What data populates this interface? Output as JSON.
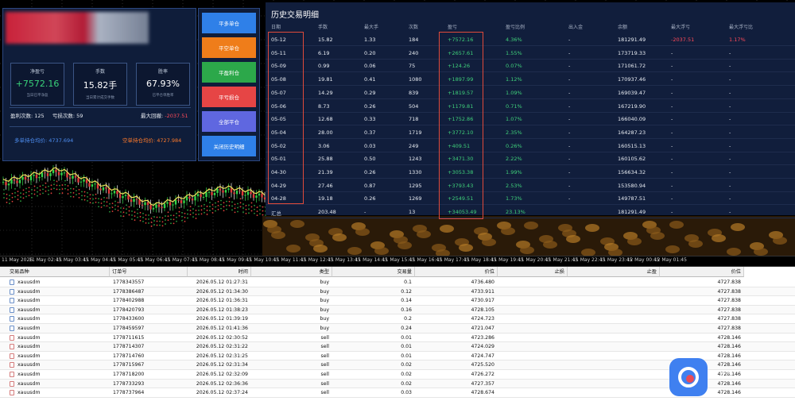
{
  "stats": {
    "cards": [
      {
        "title": "净盈亏",
        "value": "+7572.16",
        "sub": "当日已平净盈",
        "color": "#39d27a"
      },
      {
        "title": "手数",
        "value": "15.82手",
        "sub": "当日累计成交手数",
        "color": "#ffffff"
      },
      {
        "title": "胜率",
        "value": "67.93%",
        "sub": "已平仓单胜率",
        "color": "#ffffff"
      }
    ],
    "win_label": "盈利次数:",
    "win_count": "125",
    "loss_label": "亏损次数:",
    "loss_count": "59",
    "drawdown_label": "最大回撤:",
    "drawdown_value": "-2037.51",
    "long_label": "多单持仓均价:",
    "long_value": "4737.694",
    "short_label": "空单持仓均价:",
    "short_value": "4727.984"
  },
  "buttons": [
    {
      "label": "平多单仓",
      "color": "#2f80e8"
    },
    {
      "label": "平空单仓",
      "color": "#ef7d1a"
    },
    {
      "label": "平盈利仓",
      "color": "#2ca84a"
    },
    {
      "label": "平亏损仓",
      "color": "#e64545"
    },
    {
      "label": "全部平仓",
      "color": "#5f67e0"
    },
    {
      "label": "关闭历史明细",
      "color": "#2f80e8"
    }
  ],
  "history": {
    "title": "历史交易明细",
    "headers": [
      "日期",
      "手数",
      "最大手",
      "次数",
      "盈亏",
      "盈亏比例",
      "出入金",
      "余额",
      "最大浮亏",
      "最大浮亏比"
    ],
    "rows": [
      [
        "05-12",
        "15.82",
        "1.33",
        "184",
        "+7572.16",
        "4.36%",
        "-",
        "181291.49",
        "-2037.51",
        "1.17%"
      ],
      [
        "05-11",
        "6.19",
        "0.20",
        "240",
        "+2657.61",
        "1.55%",
        "-",
        "173719.33",
        "-",
        "-"
      ],
      [
        "05-09",
        "0.99",
        "0.06",
        "75",
        "+124.26",
        "0.07%",
        "-",
        "171061.72",
        "-",
        "-"
      ],
      [
        "05-08",
        "19.81",
        "0.41",
        "1080",
        "+1897.99",
        "1.12%",
        "-",
        "170937.46",
        "-",
        "-"
      ],
      [
        "05-07",
        "14.29",
        "0.29",
        "839",
        "+1819.57",
        "1.09%",
        "-",
        "169039.47",
        "-",
        "-"
      ],
      [
        "05-06",
        "8.73",
        "0.26",
        "504",
        "+1179.81",
        "0.71%",
        "-",
        "167219.90",
        "-",
        "-"
      ],
      [
        "05-05",
        "12.68",
        "0.33",
        "718",
        "+1752.86",
        "1.07%",
        "-",
        "166040.09",
        "-",
        "-"
      ],
      [
        "05-04",
        "28.00",
        "0.37",
        "1719",
        "+3772.10",
        "2.35%",
        "-",
        "164287.23",
        "-",
        "-"
      ],
      [
        "05-02",
        "3.06",
        "0.03",
        "249",
        "+409.51",
        "0.26%",
        "-",
        "160515.13",
        "-",
        "-"
      ],
      [
        "05-01",
        "25.88",
        "0.50",
        "1243",
        "+3471.30",
        "2.22%",
        "-",
        "160105.62",
        "-",
        "-"
      ],
      [
        "04-30",
        "21.39",
        "0.26",
        "1330",
        "+3053.38",
        "1.99%",
        "-",
        "156634.32",
        "-",
        "-"
      ],
      [
        "04-29",
        "27.46",
        "0.87",
        "1295",
        "+3793.43",
        "2.53%",
        "-",
        "153580.94",
        "-",
        "-"
      ],
      [
        "04-28",
        "19.18",
        "0.26",
        "1269",
        "+2549.51",
        "1.73%",
        "-",
        "149787.51",
        "-",
        "-"
      ]
    ],
    "total": [
      "汇总",
      "203.48",
      "-",
      "13",
      "+34053.49",
      "23.13%",
      "",
      "181291.49",
      "-",
      "-"
    ]
  },
  "time_axis": [
    "11 May 2026",
    "11 May 02:45",
    "11 May 03:45",
    "11 May 04:45",
    "11 May 05:45",
    "11 May 06:45",
    "11 May 07:45",
    "11 May 08:45",
    "11 May 09:45",
    "11 May 10:45",
    "11 May 11:45",
    "11 May 12:45",
    "11 May 13:45",
    "11 May 14:45",
    "11 May 15:45",
    "11 May 16:45",
    "11 May 17:45",
    "11 May 18:45",
    "11 May 19:45",
    "11 May 20:45",
    "11 May 21:45",
    "11 May 22:45",
    "11 May 23:45",
    "12 May 00:45",
    "12 May 01:45"
  ],
  "orders": {
    "headers": [
      "交易品种",
      "订单号",
      "时间",
      "类型",
      "交易量",
      "价位",
      "止损",
      "止盈",
      "价位"
    ],
    "rows": [
      [
        "xauusdm",
        "1778343557",
        "2026.05.12 01:27:31",
        "buy",
        "0.1",
        "4736.480",
        "",
        "",
        "4727.838"
      ],
      [
        "xauusdm",
        "1778386487",
        "2026.05.12 01:34:30",
        "buy",
        "0.12",
        "4733.911",
        "",
        "",
        "4727.838"
      ],
      [
        "xauusdm",
        "1778402988",
        "2026.05.12 01:36:31",
        "buy",
        "0.14",
        "4730.917",
        "",
        "",
        "4727.838"
      ],
      [
        "xauusdm",
        "1778420793",
        "2026.05.12 01:38:23",
        "buy",
        "0.16",
        "4728.105",
        "",
        "",
        "4727.838"
      ],
      [
        "xauusdm",
        "1778433600",
        "2026.05.12 01:39:19",
        "buy",
        "0.2",
        "4724.723",
        "",
        "",
        "4727.838"
      ],
      [
        "xauusdm",
        "1778459597",
        "2026.05.12 01:41:36",
        "buy",
        "0.24",
        "4721.047",
        "",
        "",
        "4727.838"
      ],
      [
        "xauusdm",
        "1778711615",
        "2026.05.12 02:30:52",
        "sell",
        "0.01",
        "4723.286",
        "",
        "",
        "4728.146"
      ],
      [
        "xauusdm",
        "1778714307",
        "2026.05.12 02:31:22",
        "sell",
        "0.01",
        "4724.029",
        "",
        "",
        "4728.146"
      ],
      [
        "xauusdm",
        "1778714760",
        "2026.05.12 02:31:25",
        "sell",
        "0.01",
        "4724.747",
        "",
        "",
        "4728.146"
      ],
      [
        "xauusdm",
        "1778715967",
        "2026.05.12 02:31:34",
        "sell",
        "0.02",
        "4725.520",
        "",
        "",
        "4728.146"
      ],
      [
        "xauusdm",
        "1778718200",
        "2026.05.12 02:32:09",
        "sell",
        "0.02",
        "4726.272",
        "",
        "",
        "4728.146"
      ],
      [
        "xauusdm",
        "1778733293",
        "2026.05.12 02:36:36",
        "sell",
        "0.02",
        "4727.357",
        "",
        "",
        "4728.146"
      ],
      [
        "xauusdm",
        "1778737964",
        "2026.05.12 02:37:24",
        "sell",
        "0.03",
        "4728.674",
        "",
        "",
        "4728.146"
      ]
    ]
  },
  "watermark": "…"
}
